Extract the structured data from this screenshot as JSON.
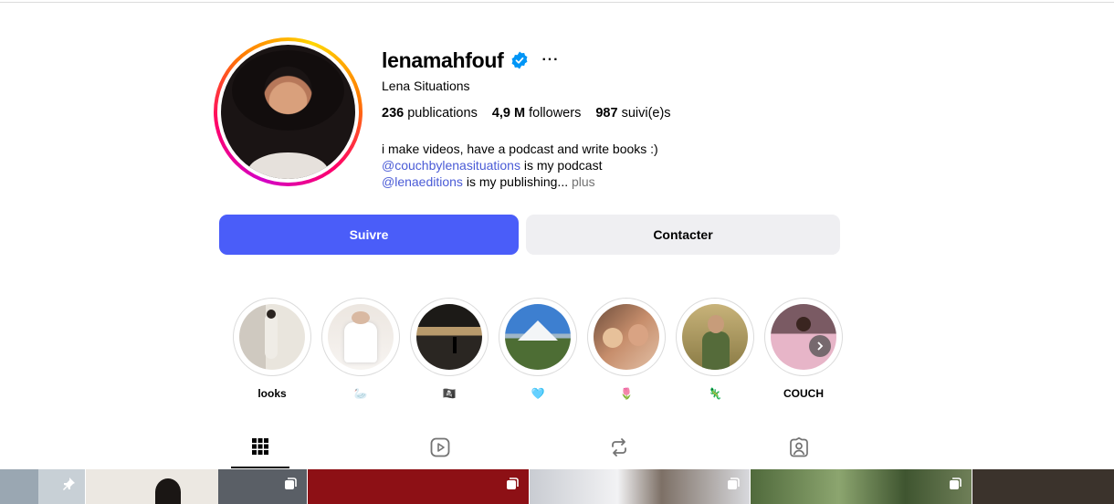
{
  "profile": {
    "username": "lenamahfouf",
    "more_label": "···",
    "full_name": "Lena Situations",
    "stats": {
      "posts_count": "236",
      "posts_label": "publications",
      "followers_count": "4,9 M",
      "followers_label": "followers",
      "following_count": "987",
      "following_label": "suivi(e)s"
    },
    "bio": {
      "line1": "i make videos, have a podcast and write books :)",
      "line2_link": "@couchbylenasituations",
      "line2_text": " is my podcast",
      "line3_link": "@lenaeditions",
      "line3_text": " is my publishing... ",
      "more_label": "plus"
    }
  },
  "actions": {
    "follow_label": "Suivre",
    "contact_label": "Contacter"
  },
  "highlights": [
    {
      "label": "looks"
    },
    {
      "label": "🦢"
    },
    {
      "label": "🏴‍☠️"
    },
    {
      "label": "🩵"
    },
    {
      "label": "🌷"
    },
    {
      "label": "🦎"
    },
    {
      "label": "COUCH"
    }
  ],
  "tabs": [
    {
      "name": "posts-tab",
      "icon": "grid-icon"
    },
    {
      "name": "reels-tab",
      "icon": "reels-icon"
    },
    {
      "name": "reposts-tab",
      "icon": "repost-icon"
    },
    {
      "name": "tagged-tab",
      "icon": "tagged-icon"
    }
  ],
  "colors": {
    "follow_button": "#4a5df9",
    "contact_button": "#efeff2",
    "link": "#4a5bd6",
    "verified": "#0095f6"
  }
}
